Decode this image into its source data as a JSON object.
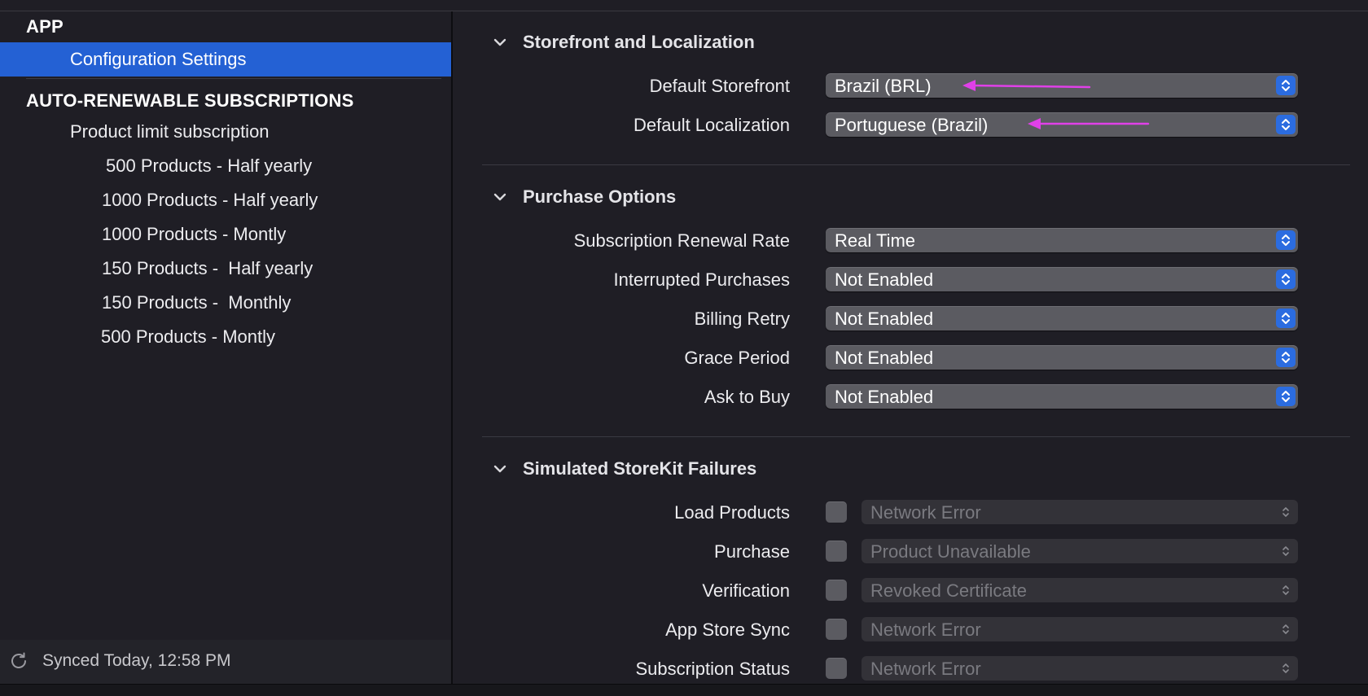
{
  "sidebar": {
    "app_heading": "APP",
    "selected_item": "Configuration Settings",
    "subs_heading": "AUTO-RENEWABLE SUBSCRIPTIONS",
    "group_label": "Product limit subscription",
    "products": [
      "500 Products - Half yearly",
      "1000 Products - Half yearly",
      "1000 Products - Montly",
      "150 Products -  Half yearly",
      "150 Products -  Monthly",
      "500 Products - Montly"
    ],
    "sync_status": "Synced Today, 12:58 PM"
  },
  "sections": {
    "storefront": {
      "title": "Storefront and Localization",
      "rows": [
        {
          "label": "Default Storefront",
          "value": "Brazil (BRL)"
        },
        {
          "label": "Default Localization",
          "value": "Portuguese (Brazil)"
        }
      ]
    },
    "purchase": {
      "title": "Purchase Options",
      "rows": [
        {
          "label": "Subscription Renewal Rate",
          "value": "Real Time"
        },
        {
          "label": "Interrupted Purchases",
          "value": "Not Enabled"
        },
        {
          "label": "Billing Retry",
          "value": "Not Enabled"
        },
        {
          "label": "Grace Period",
          "value": "Not Enabled"
        },
        {
          "label": "Ask to Buy",
          "value": "Not Enabled"
        }
      ]
    },
    "failures": {
      "title": "Simulated StoreKit Failures",
      "rows": [
        {
          "label": "Load Products",
          "value": "Network Error",
          "checked": false
        },
        {
          "label": "Purchase",
          "value": "Product Unavailable",
          "checked": false
        },
        {
          "label": "Verification",
          "value": "Revoked Certificate",
          "checked": false
        },
        {
          "label": "App Store Sync",
          "value": "Network Error",
          "checked": false
        },
        {
          "label": "Subscription Status",
          "value": "Network Error",
          "checked": false
        }
      ]
    }
  },
  "colors": {
    "background": "#1f1e25",
    "selection": "#2461d4",
    "popup": "#5b5b61",
    "stepper_accent": "#2b6ce0",
    "annotation_arrow": "#e040e8"
  },
  "icons": {
    "sync": "sync-icon",
    "disclosure": "chevron-down-icon",
    "stepper": "up-down-chevron-icon",
    "annotation": "arrow-left-icon"
  }
}
